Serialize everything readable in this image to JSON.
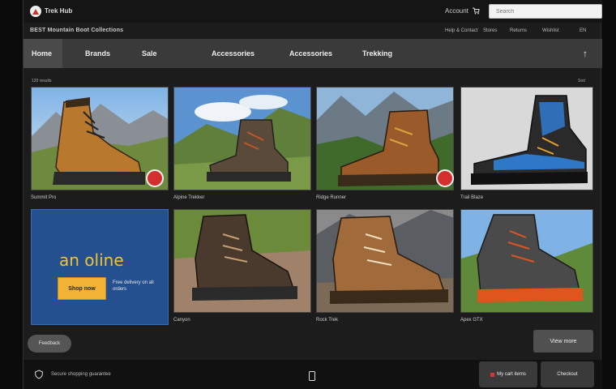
{
  "header": {
    "brand": "Trek Hub",
    "account_link": "Account",
    "search_placeholder": "Search"
  },
  "info_row": {
    "breadcrumb": "BEST Mountain Boot Collections",
    "links": [
      "Help & Contact",
      "Stores",
      "Returns",
      "Wishlist",
      "EN"
    ]
  },
  "nav": {
    "tabs": [
      "Home",
      "Brands",
      "Sale",
      "Accessories",
      "Accessories",
      "Trekking"
    ]
  },
  "grid": {
    "results_count": "120 results",
    "sort_label": "Sort",
    "tiles": [
      {
        "label": "Summit Pro"
      },
      {
        "label": "Alpine Trekker"
      },
      {
        "label": "Ridge Runner"
      },
      {
        "label": "Trail Blaze"
      },
      {
        "label": "Canyon"
      },
      {
        "label": "Rock Trek"
      },
      {
        "label": "Apex GTX"
      }
    ]
  },
  "promo": {
    "title": "an oline",
    "button": "Shop now",
    "text": "Free delivery on all orders"
  },
  "controls": {
    "chat": "Feedback",
    "more": "View more"
  },
  "footer": {
    "text": "Secure shopping guarantee",
    "cart": "My cart items",
    "checkout": "Checkout"
  },
  "colors": {
    "sale_badge": "#d32f2f",
    "promo_bg": "#24508f",
    "promo_accent": "#f2c230"
  },
  "icons": [
    "logo-icon",
    "cart-icon",
    "shield-icon",
    "phone-icon",
    "arrow-icon",
    "sale-badge-icon"
  ]
}
